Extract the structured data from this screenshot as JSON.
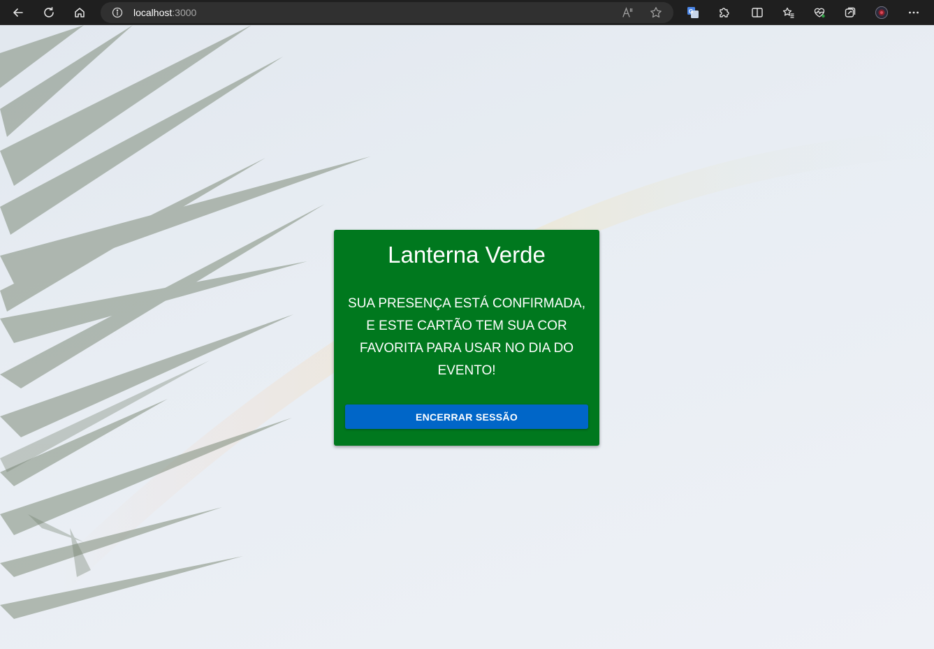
{
  "browser": {
    "url_host": "localhost",
    "url_port": ":3000",
    "icons": {
      "back": "back-arrow-icon",
      "reload": "reload-icon",
      "home": "home-icon",
      "site_info": "info-icon",
      "read_aloud": "read-aloud-icon",
      "favorite": "star-icon",
      "translate": "translate-icon",
      "extensions": "puzzle-icon",
      "split_screen": "split-screen-icon",
      "favorites": "favorites-icon",
      "performance": "heartbeat-icon",
      "collections": "collections-icon",
      "profile": "avatar",
      "more": "more-icon"
    }
  },
  "card": {
    "title": "Lanterna Verde",
    "message": "SUA PRESENÇA ESTÁ CONFIRMADA, E ESTE CARTÃO TEM SUA COR FAVORITA PARA USAR NO DIA DO EVENTO!",
    "button_label": "ENCERRAR SESSÃO",
    "background_color": "#00781e",
    "button_color": "#0066c8"
  }
}
